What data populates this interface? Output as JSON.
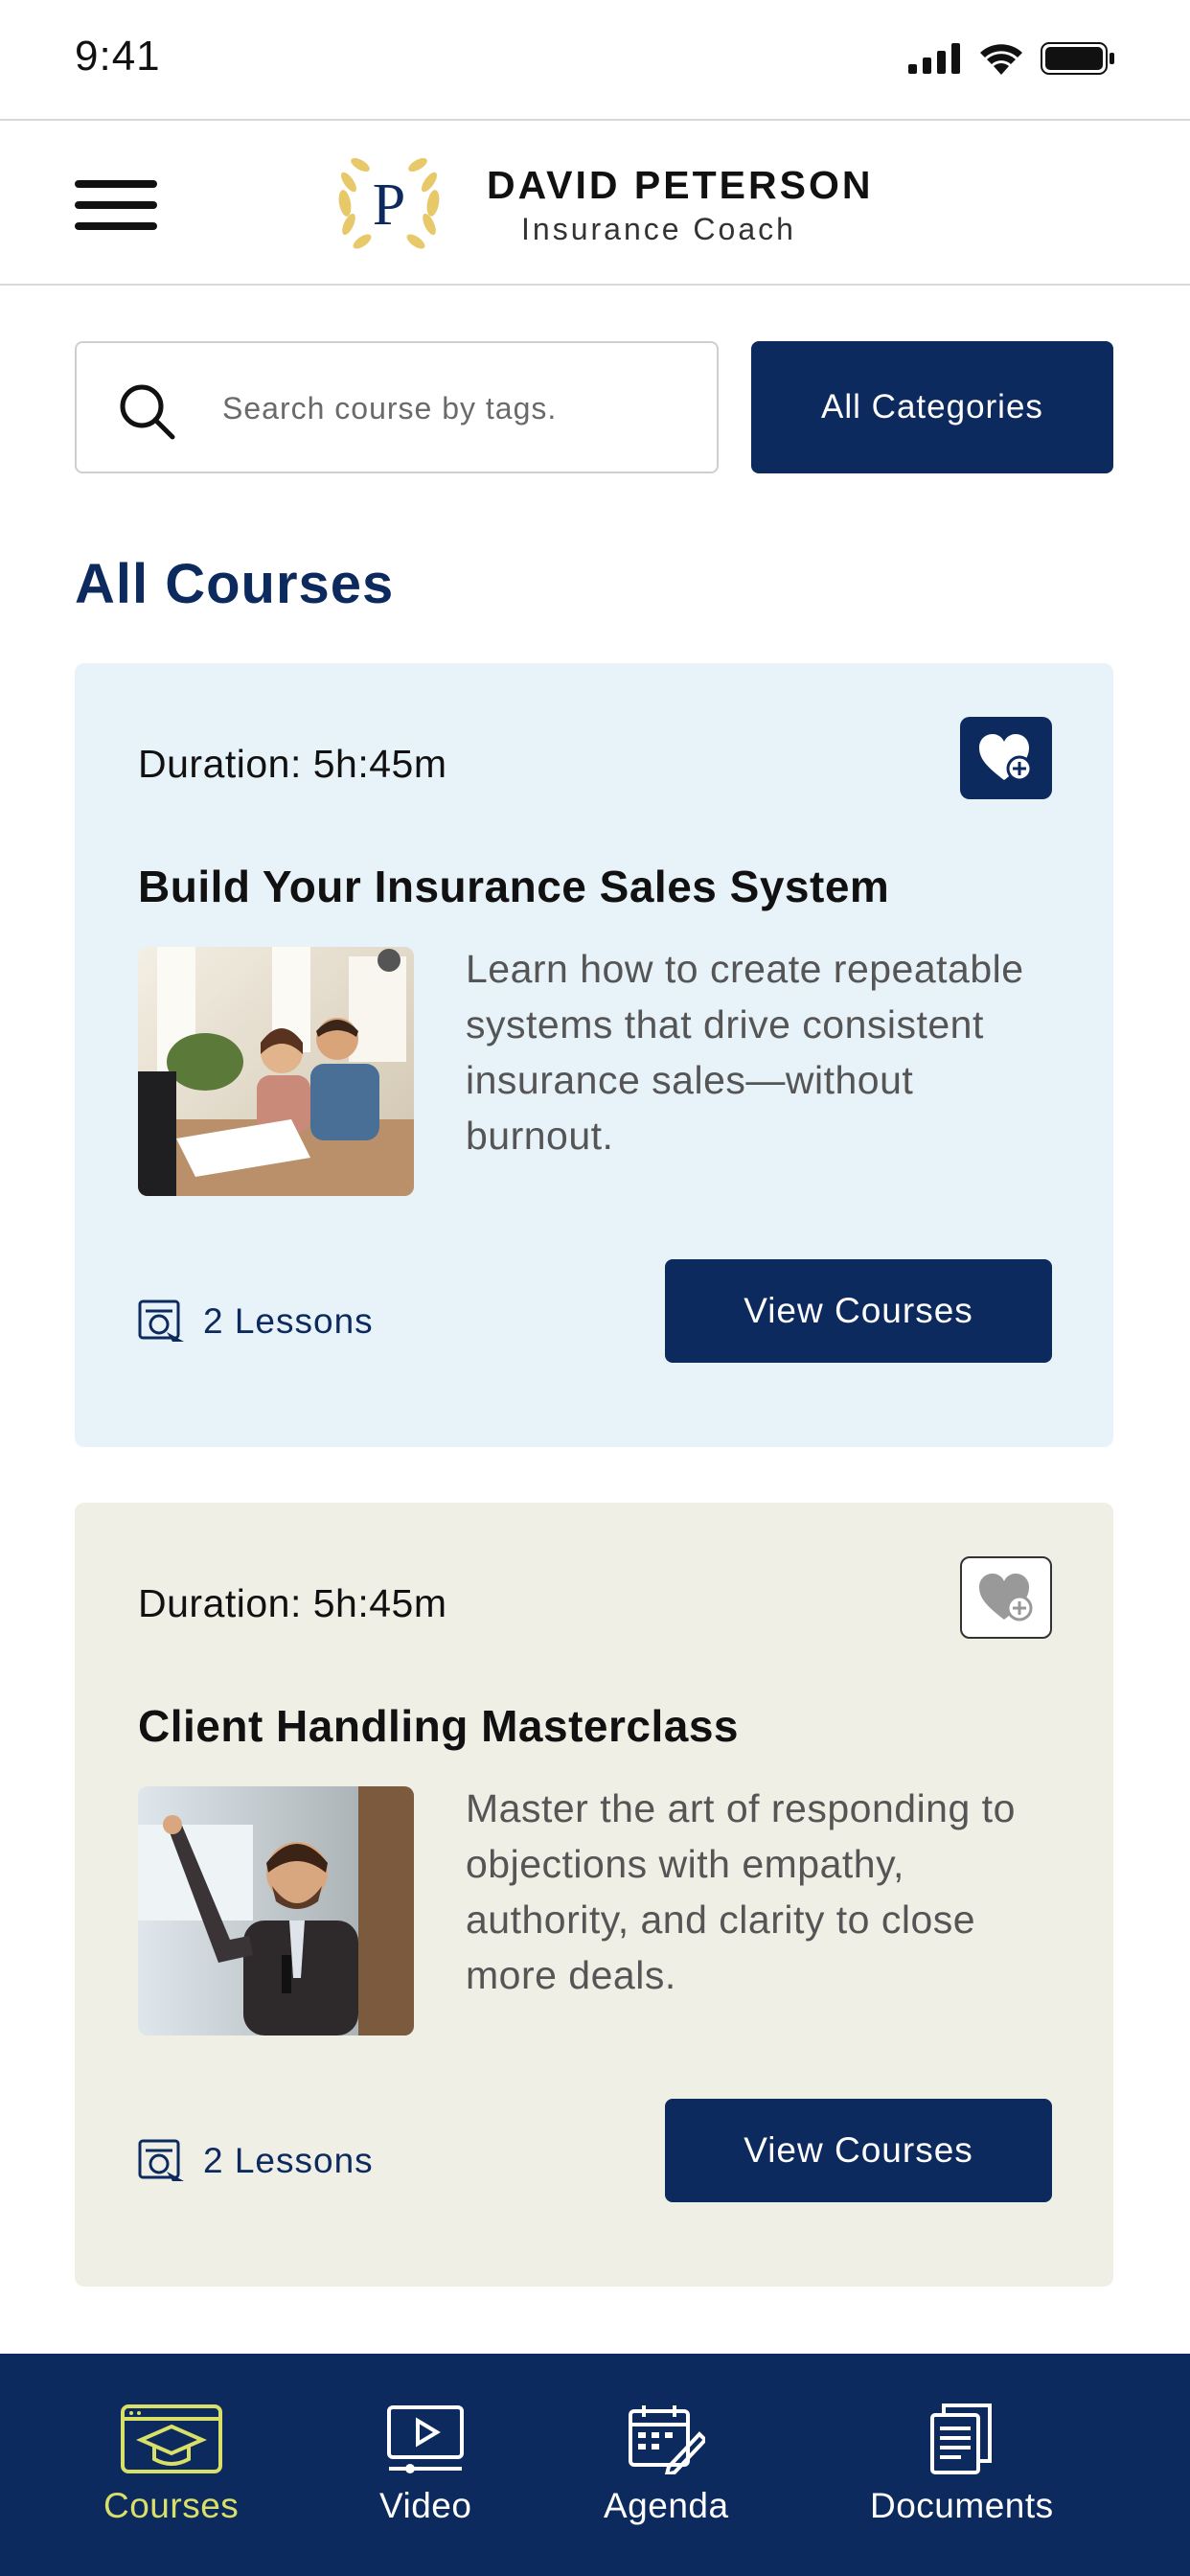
{
  "status_bar": {
    "time": "9:41"
  },
  "header": {
    "logo_letter": "P",
    "brand_name": "DAVID PETERSON",
    "brand_subtitle": "Insurance Coach"
  },
  "search": {
    "placeholder": "Search course by tags.",
    "value": "",
    "categories_label": "All Categories"
  },
  "section_title": "All Courses",
  "courses": [
    {
      "duration": "Duration: 5h:45m",
      "title": "Build Your Insurance Sales System",
      "description": "Learn how to create repeatable systems that drive consistent insurance sales—without burnout.",
      "lessons": "2 Lessons",
      "button_label": "View Courses",
      "favorited": true,
      "background": "#e8f2f9"
    },
    {
      "duration": "Duration: 5h:45m",
      "title": "Client Handling Masterclass",
      "description": "Master the art of responding to objections with empathy, authority, and clarity to close more deals.",
      "lessons": "2 Lessons",
      "button_label": "View Courses",
      "favorited": false,
      "background": "#efefe6"
    }
  ],
  "bottom_nav": {
    "items": [
      {
        "label": "Courses",
        "icon": "graduation-cap-icon",
        "active": true
      },
      {
        "label": "Video",
        "icon": "video-play-icon",
        "active": false
      },
      {
        "label": "Agenda",
        "icon": "calendar-icon",
        "active": false
      },
      {
        "label": "Documents",
        "icon": "documents-icon",
        "active": false
      }
    ]
  },
  "colors": {
    "primary": "#0d2a5f",
    "active_nav": "#d8e068",
    "card_blue": "#e8f2f9",
    "card_beige": "#efefe6",
    "logo_gold": "#e8c96a"
  }
}
